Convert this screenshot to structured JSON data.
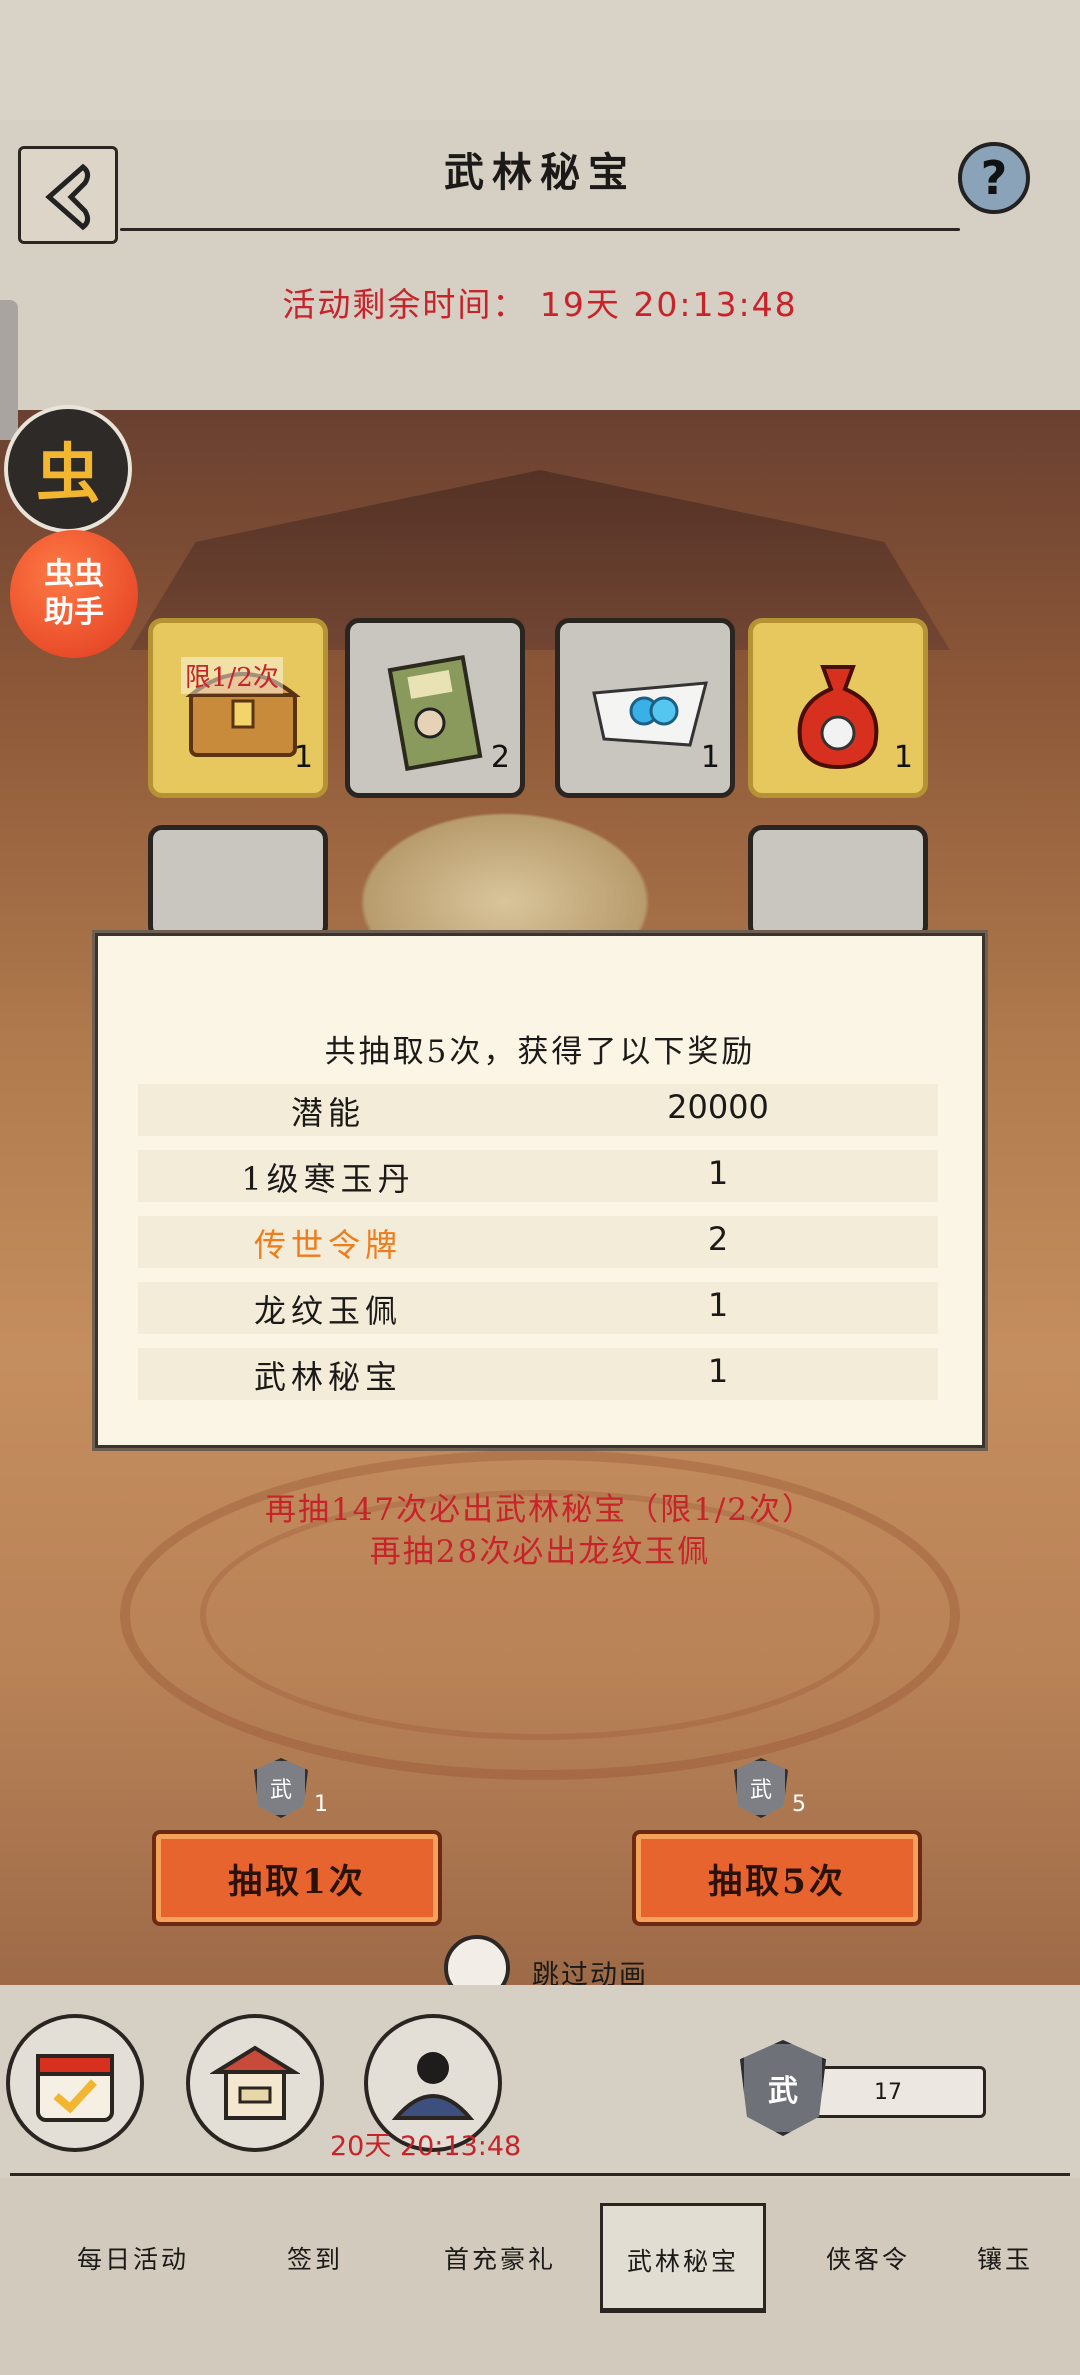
{
  "header": {
    "title": "武林秘宝",
    "countdown_label": "活动剩余时间：",
    "countdown_value": "19天 20:13:48"
  },
  "overlay": {
    "bug_glyph": "虫",
    "helper_label": "虫虫助手"
  },
  "prize_cards": [
    {
      "tag": "限1/2次",
      "count": "1",
      "icon": "treasure-chest-icon"
    },
    {
      "tag": "",
      "count": "2",
      "icon": "manual-book-icon"
    },
    {
      "tag": "",
      "count": "1",
      "icon": "jade-pendant-icon"
    },
    {
      "tag": "",
      "count": "1",
      "icon": "money-bag-icon"
    }
  ],
  "modal": {
    "title": "共抽取5次，获得了以下奖励",
    "rewards": [
      {
        "name": "潜能",
        "qty": "20000"
      },
      {
        "name": "1级寒玉丹",
        "qty": "1"
      },
      {
        "name": "传世令牌",
        "qty": "2"
      },
      {
        "name": "龙纹玉佩",
        "qty": "1"
      },
      {
        "name": "武林秘宝",
        "qty": "1"
      }
    ]
  },
  "pity": {
    "line1": "再抽147次必出武林秘宝（限1/2次）",
    "line2": "再抽28次必出龙纹玉佩"
  },
  "draw": {
    "one": {
      "label": "抽取1次",
      "cost": "1",
      "token_glyph": "武"
    },
    "five": {
      "label": "抽取5次",
      "cost": "5",
      "token_glyph": "武"
    },
    "skip_label": "跳过动画"
  },
  "bottom": {
    "timer": "20天 20:13:48",
    "currency_glyph": "武",
    "currency_count": "17"
  },
  "tabs": [
    {
      "label": "每日活动",
      "active": false
    },
    {
      "label": "签到",
      "active": false
    },
    {
      "label": "首充豪礼",
      "active": false
    },
    {
      "label": "武林秘宝",
      "active": true
    },
    {
      "label": "侠客令",
      "active": false
    },
    {
      "label": "镶玉",
      "active": false
    }
  ],
  "colors": {
    "accent_red": "#c8232a",
    "button_orange": "#e8642f",
    "highlight_orange": "#f07c1c",
    "panel_bg": "#d6d0c4",
    "modal_bg": "#fbf5e6"
  }
}
